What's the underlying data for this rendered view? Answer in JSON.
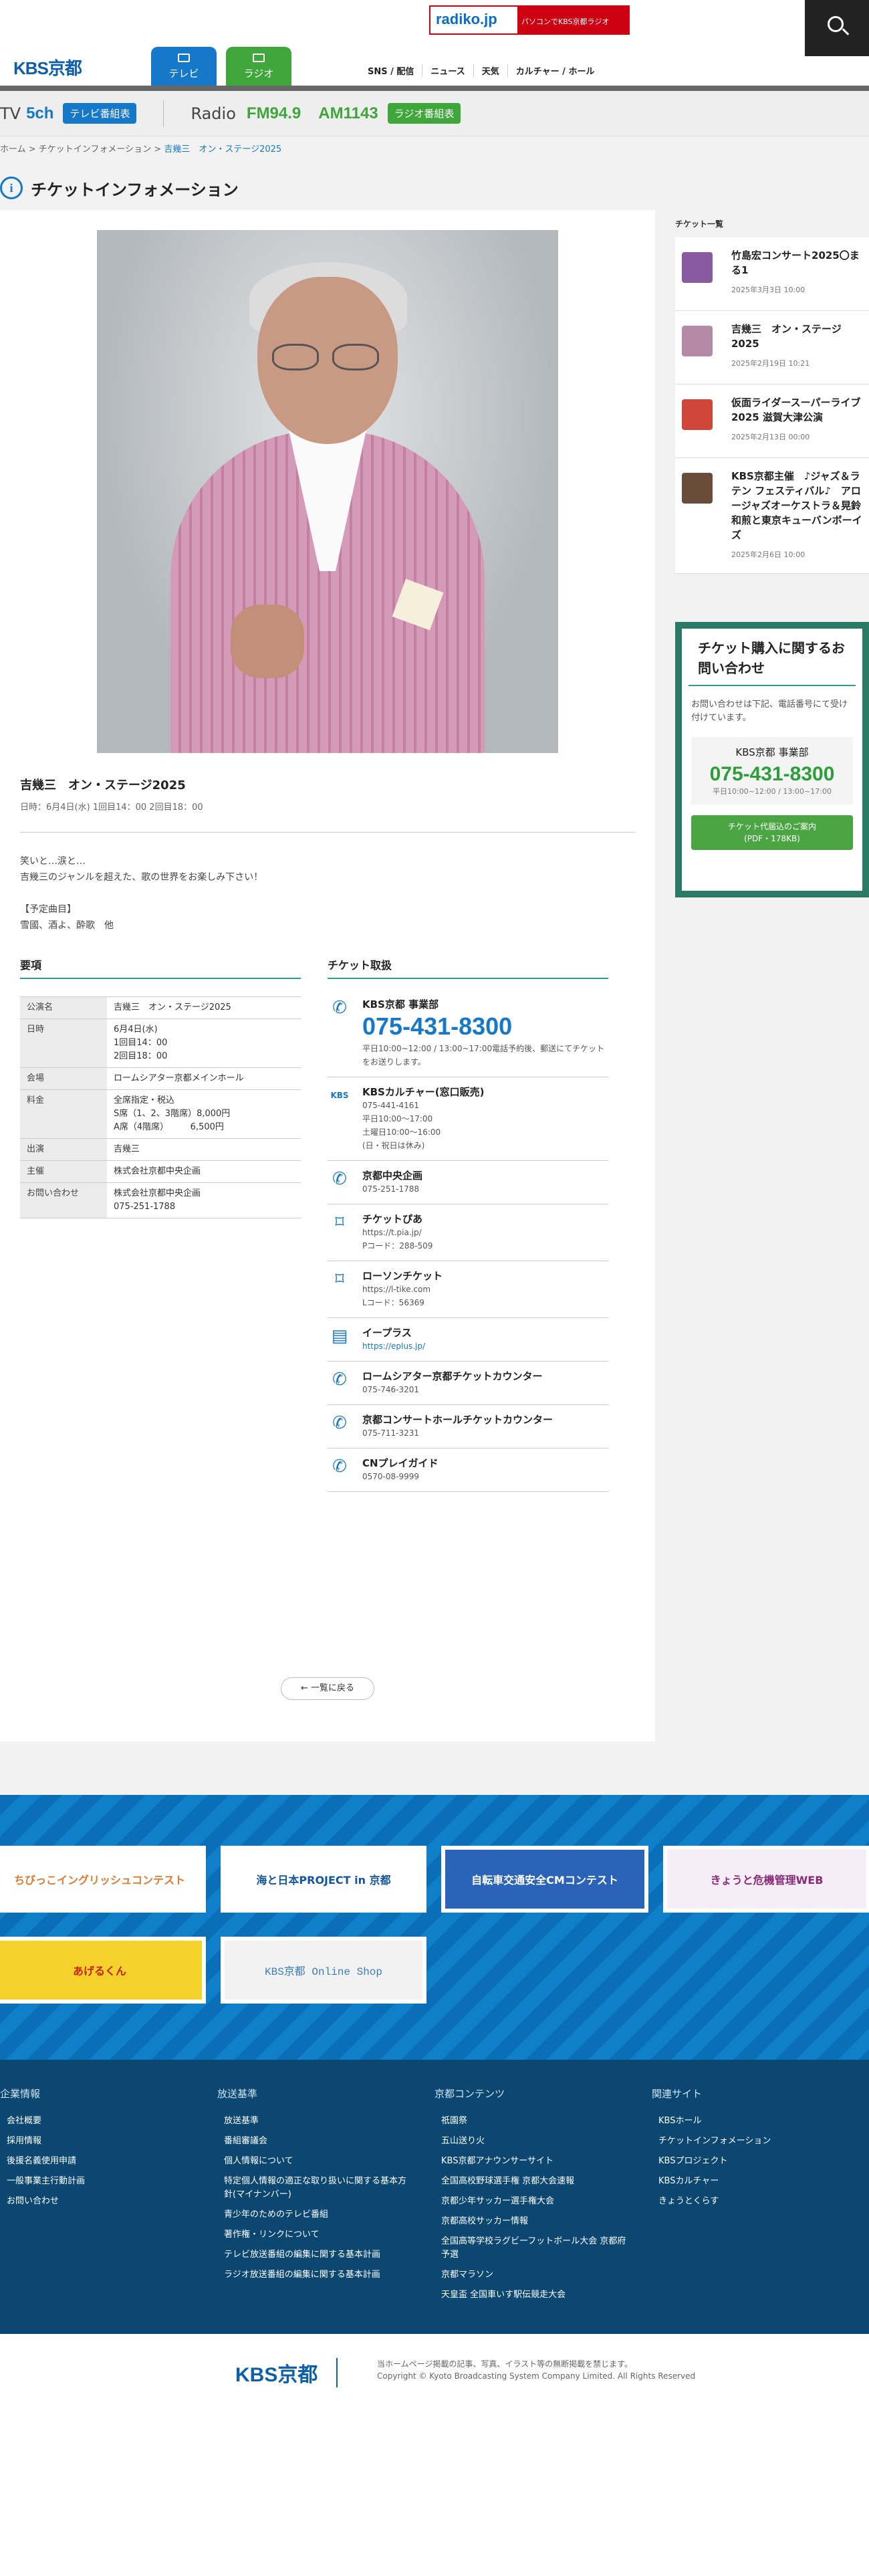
{
  "header": {
    "logo": "KBS京都",
    "radiko_logo": "radiko.jp",
    "radiko_text": "パソコンでKBS京都ラジオ",
    "tab_tv": "テレビ",
    "tab_radio": "ラジオ",
    "nav": [
      "SNS / 配信",
      "ニュース",
      "天気",
      "カルチャー / ホール"
    ]
  },
  "channels": {
    "tv_label": "TV",
    "tv_ch": "5ch",
    "tv_button": "テレビ番組表",
    "radio_label": "Radio",
    "fm": "FM94.9",
    "am": "AM1143",
    "radio_button": "ラジオ番組表"
  },
  "breadcrumb": {
    "home": "ホーム",
    "section": "チケットインフォメーション",
    "current": "吉幾三　オン・ステージ2025"
  },
  "page_title": "チケットインフォメーション",
  "event": {
    "title": "吉幾三　オン・ステージ2025",
    "date": "日時：6月4日(水) 1回目14：00 2回目18：00",
    "desc": [
      "笑いと…涙と…",
      "吉幾三のジャンルを超えた、歌の世界をお楽しみ下さい！",
      "",
      "【予定曲目】",
      "雪國、酒よ、酔歌　他"
    ]
  },
  "overview": {
    "heading": "要項",
    "rows": [
      {
        "k": "公演名",
        "v": "吉幾三　オン・ステージ2025"
      },
      {
        "k": "日時",
        "v": "6月4日(水)\n1回目14：00\n2回目18：00"
      },
      {
        "k": "会場",
        "v": "ロームシアター京都メインホール"
      },
      {
        "k": "料金",
        "v": "全席指定・税込\nS席（1、2、3階席）8,000円\nA席（4階席）　　　6,500円"
      },
      {
        "k": "出演",
        "v": "吉幾三"
      },
      {
        "k": "主催",
        "v": "株式会社京都中央企画"
      },
      {
        "k": "お問い合わせ",
        "v": "株式会社京都中央企画\n075-251-1788"
      }
    ]
  },
  "tickets": {
    "heading": "チケット取扱",
    "items": [
      {
        "icon": "phone-icon",
        "name": "KBS京都 事業部",
        "big": "075-431-8300",
        "lines": [
          "平日10:00~12:00 / 13:00~17:00電話予約後、郵送にてチケットをお送りします。"
        ]
      },
      {
        "icon": "kbs-culture-icon",
        "name": "KBSカルチャー(窓口販売)",
        "lines": [
          "075-441-4161",
          "平日10:00〜17:00",
          "土曜日10:00〜16:00",
          "(日・祝日は休み)"
        ]
      },
      {
        "icon": "phone-icon",
        "name": "京都中央企画",
        "lines": [
          "075-251-1788"
        ]
      },
      {
        "icon": "ticket-icon",
        "name": "チケットぴあ",
        "lines": [
          "https://t.pia.jp/",
          "Pコード：288-509"
        ]
      },
      {
        "icon": "ticket-icon",
        "name": "ローソンチケット",
        "lines": [
          "https://l-tike.com",
          "Lコード：56369"
        ]
      },
      {
        "icon": "eplus-icon",
        "name": "イープラス",
        "link": "https://eplus.jp/",
        "lines": []
      },
      {
        "icon": "phone-icon",
        "name": "ロームシアター京都チケットカウンター",
        "lines": [
          "075-746-3201"
        ]
      },
      {
        "icon": "phone-icon",
        "name": "京都コンサートホールチケットカウンター",
        "lines": [
          "075-711-3231"
        ]
      },
      {
        "icon": "phone-icon",
        "name": "CNプレイガイド",
        "lines": [
          "0570-08-9999"
        ]
      }
    ]
  },
  "back_label": "一覧に戻る",
  "sidebar": {
    "heading": "チケット一覧",
    "items": [
      {
        "title": "竹島宏コンサート2025〇まる1",
        "date": "2025年3月3日 10:00",
        "color": "#8a5aa0"
      },
      {
        "title": "吉幾三　オン・ステージ2025",
        "date": "2025年2月19日 10:21",
        "color": "#b58aa6"
      },
      {
        "title": "仮面ライダースーパーライブ2025 滋賀大津公演",
        "date": "2025年2月13日 00:00",
        "color": "#d0473a"
      },
      {
        "title": "KBS京都主催　♪ジャズ＆ラテン フェスティバル♪　アロージャズオーケストラ＆晃鈴和煎と東京キューバンボーイズ",
        "date": "2025年2月6日 10:00",
        "color": "#6b4b3a"
      }
    ]
  },
  "contact": {
    "title": "チケット購入に関するお問い合わせ",
    "text": "お問い合わせは下記、電話番号にて受け付けています。",
    "dept": "KBS京都 事業部",
    "phone": "075-431-8300",
    "hours": "平日10:00~12:00 / 13:00~17:00",
    "button": "チケット代届込のご案内\n(PDF・178KB)"
  },
  "banners": [
    "ちびっこイングリッシュコンテスト",
    "海と日本PROJECT in 京都",
    "自転車交通安全CMコンテスト",
    "きょうと危機管理WEB",
    "あげるくん",
    "KBS京都 Online Shop"
  ],
  "footer": {
    "cols": [
      {
        "title": "企業情報",
        "items": [
          "会社概要",
          "採用情報",
          "後援名義使用申請",
          "一般事業主行動計画",
          "お問い合わせ"
        ]
      },
      {
        "title": "放送基準",
        "items": [
          "放送基準",
          "番組審議会",
          "個人情報について",
          "特定個人情報の適正な取り扱いに関する基本方針(マイナンバー)",
          "青少年のためのテレビ番組",
          "著作権・リンクについて",
          "テレビ放送番組の編集に関する基本計画",
          "ラジオ放送番組の編集に関する基本計画"
        ]
      },
      {
        "title": "京都コンテンツ",
        "items": [
          "祇園祭",
          "五山送り火",
          "KBS京都アナウンサーサイト",
          "全国高校野球選手権 京都大会速報",
          "京都少年サッカー選手権大会",
          "京都高校サッカー情報",
          "全国高等学校ラグビーフットボール大会 京都府予選",
          "京都マラソン",
          "天皇盃 全国車いす駅伝競走大会"
        ]
      },
      {
        "title": "関連サイト",
        "items": [
          "KBSホール",
          "チケットインフォメーション",
          "KBSプロジェクト",
          "KBSカルチャー",
          "きょうとくらす"
        ]
      }
    ]
  },
  "bottom": {
    "logo": "KBS京都",
    "note1": "当ホームページ掲載の記事、写真、イラスト等の無断掲載を禁じます。",
    "note2": "Copyright © Kyoto Broadcasting System Company Limited. All Rights Reserved"
  }
}
